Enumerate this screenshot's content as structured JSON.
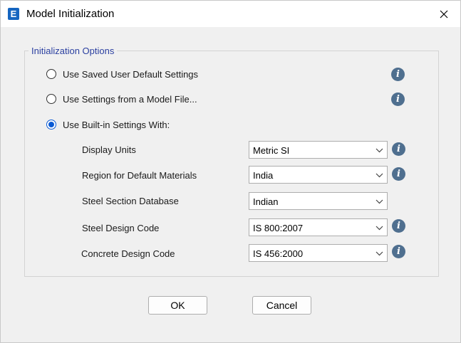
{
  "window": {
    "title": "Model Initialization",
    "app_icon_letter": "E"
  },
  "group": {
    "title": "Initialization Options"
  },
  "options": [
    {
      "label": "Use Saved User Default Settings",
      "checked": false
    },
    {
      "label": "Use Settings from a Model File...",
      "checked": false
    },
    {
      "label": "Use Built-in Settings With:",
      "checked": true
    }
  ],
  "fields": [
    {
      "label": "Display Units",
      "value": "Metric SI",
      "has_info": true
    },
    {
      "label": "Region for Default Materials",
      "value": "India",
      "has_info": true
    },
    {
      "label": "Steel Section Database",
      "value": "Indian",
      "has_info": false
    },
    {
      "label": "Steel Design Code",
      "value": "IS 800:2007",
      "has_info": true
    },
    {
      "label": "Concrete Design Code",
      "value": "IS 456:2000",
      "has_info": true
    }
  ],
  "buttons": {
    "ok": "OK",
    "cancel": "Cancel"
  },
  "colors": {
    "accent": "#0a5ad4",
    "group_title": "#2a3fa0",
    "info_icon": "#4f6f8f",
    "app_icon": "#1565c0"
  }
}
